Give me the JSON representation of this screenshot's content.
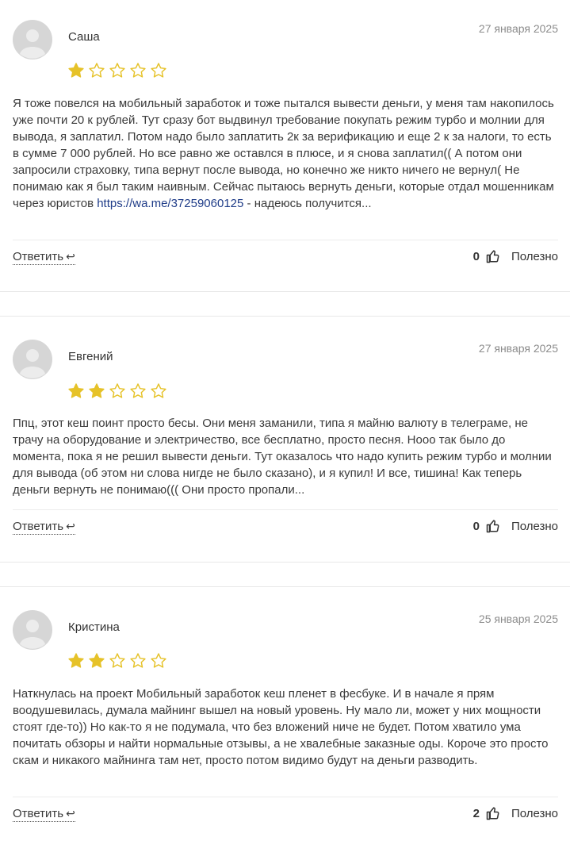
{
  "reviews": [
    {
      "author": "Саша",
      "date": "27 января 2025",
      "rating": 1,
      "text_before_link": "Я тоже повелся на мобильный заработок и тоже пытался вывести деньги, у меня там накопилось уже почти 20 к рублей. Тут сразу бот выдвинул требование покупать режим турбо и молнии для вывода, я заплатил. Потом надо было заплатить 2к за верификацию и еще 2 к за налоги, то есть в сумме 7 000 рублей. Но все равно же оставлся в плюсе, и я снова заплатил(( А потом они запросили страховку, типа вернут после вывода, но конечно же никто ничего не вернул( Не понимаю как я был таким наивным. Сейчас пытаюсь вернуть деньги, которые отдал мошенникам через юристов ",
      "link": "https://wa.me/37259060125",
      "text_after_link": " - надеюсь получится...",
      "reply_label": "Ответить",
      "useful_count": "0",
      "useful_label": "Полезно"
    },
    {
      "author": "Евгений",
      "date": "27 января 2025",
      "rating": 2,
      "text": "Ппц, этот кеш поинт просто бесы. Они меня заманили, типа я майню валюту в телеграме, не трачу на оборудование и электричество, все бесплатно, просто песня. Нооо так было до момента, пока я не решил вывести деньги. Тут оказалось что надо купить режим турбо и молнии для вывода (об этом ни слова нигде не было сказано), и я купил! И все, тишина! Как теперь деньги вернуть не понимаю((( Они просто пропали...",
      "reply_label": "Ответить",
      "useful_count": "0",
      "useful_label": "Полезно"
    },
    {
      "author": "Кристина",
      "date": "25 января 2025",
      "rating": 2,
      "text": "Наткнулась на проект Мобильный заработок кеш пленет в фесбуке. И в начале я прям воодушевилась, думала майнинг вышел на новый уровень. Ну мало ли, может у них мощности стоят где-то)) Но как-то я не подумала, что без вложений ниче не будет. Потом хватило ума почитать обзоры и найти нормальные отзывы, а не хвалебные заказные оды. Короче это просто скам и никакого майнинга там нет, просто потом видимо будут на деньги разводить.",
      "reply_label": "Ответить",
      "useful_count": "2",
      "useful_label": "Полезно"
    }
  ],
  "colors": {
    "star_filled": "#e6c229",
    "star_empty_stroke": "#e6c229",
    "link": "#1f3c88",
    "date": "#8c8c8c"
  },
  "icons": {
    "avatar": "user-avatar-icon",
    "star": "star-icon",
    "reply": "reply-arrow-icon",
    "useful": "thumbs-up-icon"
  }
}
